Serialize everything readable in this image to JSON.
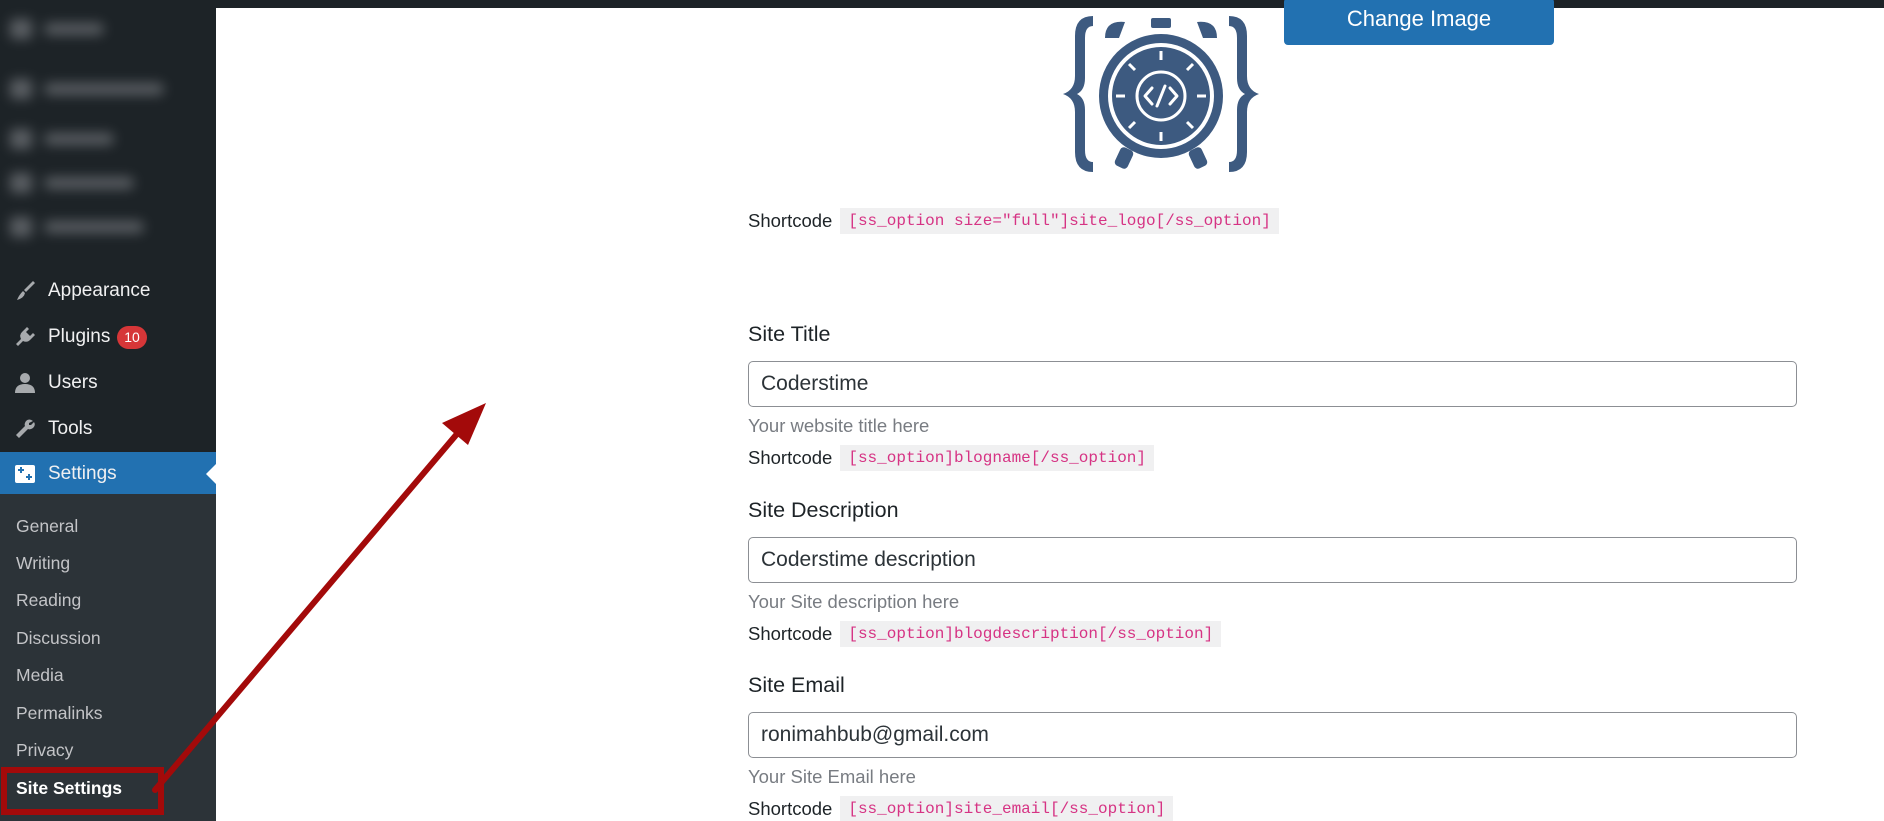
{
  "sidebar": {
    "menu": [
      {
        "id": "appearance",
        "label": "Appearance",
        "icon": "paintbrush-icon"
      },
      {
        "id": "plugins",
        "label": "Plugins",
        "icon": "plugin-icon",
        "badge": "10"
      },
      {
        "id": "users",
        "label": "Users",
        "icon": "user-icon"
      },
      {
        "id": "tools",
        "label": "Tools",
        "icon": "wrench-icon"
      },
      {
        "id": "settings",
        "label": "Settings",
        "icon": "settings-sliders-icon",
        "active": true
      }
    ],
    "submenu": [
      "General",
      "Writing",
      "Reading",
      "Discussion",
      "Media",
      "Permalinks",
      "Privacy",
      "Site Settings"
    ],
    "current_submenu": "Site Settings"
  },
  "logo": {
    "change_button": "Change Image",
    "shortcode_label": "Shortcode",
    "shortcode": "[ss_option size=\"full\"]site_logo[/ss_option]"
  },
  "fields": {
    "site_title": {
      "label": "Site Title",
      "value": "Coderstime",
      "help": "Your website title here",
      "shortcode_label": "Shortcode",
      "shortcode": "[ss_option]blogname[/ss_option]"
    },
    "site_description": {
      "label": "Site Description",
      "value": "Coderstime description",
      "help": "Your Site description here",
      "shortcode_label": "Shortcode",
      "shortcode": "[ss_option]blogdescription[/ss_option]"
    },
    "site_email": {
      "label": "Site Email",
      "value": "ronimahbub@gmail.com",
      "help": "Your Site Email here",
      "shortcode_label": "Shortcode",
      "shortcode": "[ss_option]site_email[/ss_option]"
    }
  },
  "colors": {
    "sidebar_bg": "#1d2327",
    "accent": "#2271b1",
    "badge": "#d63638",
    "annotation": "#a30a0a",
    "logo": "#3d5a80"
  }
}
